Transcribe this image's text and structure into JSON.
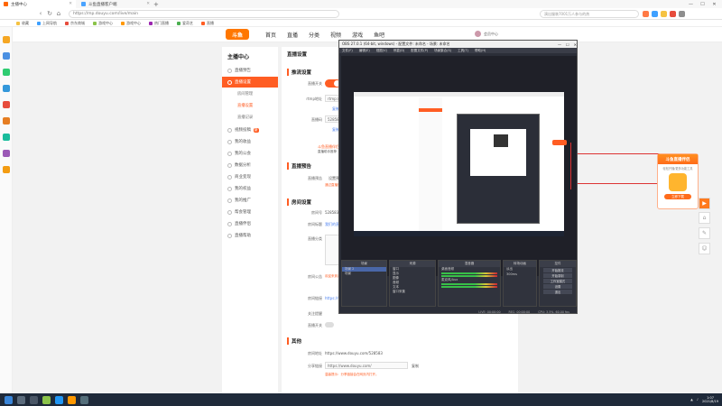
{
  "browser": {
    "tabs": [
      {
        "title": "主播中心"
      },
      {
        "title": "斗鱼直播客户端"
      }
    ],
    "address": "https://mp.douyu.com/live/main",
    "search_placeholder": "演出服装7001万人参与的热",
    "bookmarks": [
      "收藏",
      "上网导航",
      "京东商城",
      "游戏中心",
      "游戏中心",
      "热门直播",
      "爱奇艺",
      "直播"
    ]
  },
  "site": {
    "logo": "斗鱼",
    "nav": [
      "首页",
      "直播",
      "分类",
      "视频",
      "游戏",
      "鱼吧"
    ],
    "user": "会员中心",
    "menu_title": "主播中心",
    "menu": [
      {
        "label": "直播预告"
      },
      {
        "label": "直播设置",
        "active": true
      },
      {
        "label": "房间管理",
        "sub": true
      },
      {
        "label": "直播设置",
        "sub": true,
        "on": true
      },
      {
        "label": "直播记录",
        "sub": true
      },
      {
        "label": "视频投稿",
        "badge": "新"
      },
      {
        "label": "我的收益"
      },
      {
        "label": "我的公会"
      },
      {
        "label": "数据分析"
      },
      {
        "label": "商业变现"
      },
      {
        "label": "我的权益"
      },
      {
        "label": "我的推广"
      },
      {
        "label": "帮会管理"
      },
      {
        "label": "直播伴侣"
      },
      {
        "label": "直播帮助"
      }
    ]
  },
  "main": {
    "page_title": "直播设置",
    "push_title": "推流设置",
    "live_switch_label": "直播开关",
    "rtmp_label": "rtmp地址",
    "rtmp_value": "rtmp://sendtc",
    "copy": "复制",
    "code_label": "直播码",
    "code_value": "528583r5y5f5",
    "copy2": "复制",
    "tip": "斗鱼直播伴侣",
    "tip_sub": "直播助手推荐",
    "notice_title": "直播预告",
    "notice_label": "直播预告",
    "notice_value": "设置预告",
    "notice_tip": "通过直播预告，可",
    "room_title": "房间设置",
    "room_id_label": "房间号",
    "room_id": "528583",
    "room_name_label": "房间标题",
    "room_name": "我们的直播间",
    "category_label": "直播分类",
    "room_notice_label": "房间公告",
    "room_notice": "欢迎来到我的直播间",
    "link_label": "房间链接",
    "link_value": "https://www.douyu",
    "follow_label": "关注提醒",
    "guard_label": "直播开关",
    "other_title": "其他",
    "my_room_label": "房间地址",
    "my_room_value": "https://www.douyu.com/528583",
    "share_label": "分享链接",
    "share_value": "https://www.douyu.com/",
    "share_btn": "复制",
    "share_tip": "温馨提示：分享链接会在网页内打开。"
  },
  "obs": {
    "title": "OBS 27.0.1 (64-bit, windows) - 配置文件: 未命名 - 场景: 未命名",
    "menu": [
      "文件(F)",
      "编辑(E)",
      "视图(V)",
      "停靠(D)",
      "配置文件(P)",
      "场景集合(S)",
      "工具(T)",
      "帮助(H)"
    ],
    "docks": {
      "scenes": "场景",
      "sources": "来源",
      "mixer": "混音器",
      "transitions": "转场动画",
      "controls": "控件"
    },
    "scene_items": [
      "场景 2",
      "场景"
    ],
    "source_items": [
      "窗口",
      "显示",
      "图像",
      "音频",
      "文本",
      "窗口采集"
    ],
    "mixer_items": [
      "桌面音频",
      "麦克风/Aux"
    ],
    "transition": "淡出",
    "duration": "300ms",
    "controls": [
      "开始推流",
      "开始录制",
      "工作室模式",
      "设置",
      "退出"
    ],
    "status": [
      "LIVE: 00:00:00",
      "REC: 00:00:00",
      "CPU: 3.5%, 60.00 fps"
    ]
  },
  "ad": {
    "title": "斗鱼直播伴侣",
    "sub": "轻松开播/更多功能工具",
    "button": "立即下载"
  },
  "taskbar": {
    "time": "1:07",
    "date": "2021/8/19"
  }
}
